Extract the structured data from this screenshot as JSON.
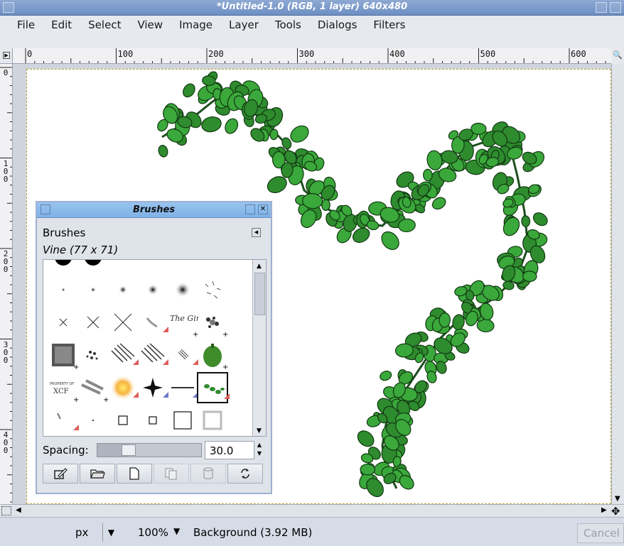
{
  "window": {
    "title": "*Untitled-1.0 (RGB, 1 layer) 640x480"
  },
  "menu": {
    "items": [
      "File",
      "Edit",
      "Select",
      "View",
      "Image",
      "Layer",
      "Tools",
      "Dialogs",
      "Filters"
    ]
  },
  "rulers": {
    "horizontal_labels": [
      "0",
      "100",
      "200",
      "300",
      "400",
      "500",
      "600"
    ],
    "vertical_labels": [
      "0",
      "100",
      "200",
      "300",
      "400"
    ]
  },
  "brushes_dialog": {
    "title": "Brushes",
    "heading": "Brushes",
    "selected_brush": "Vine (77 x 71)",
    "spacing_label": "Spacing:",
    "spacing_value": "30.0",
    "spacing_fraction": 0.3,
    "actions": [
      "edit-brush",
      "open-brush",
      "new-brush",
      "duplicate-brush",
      "delete-brush",
      "refresh-brushes"
    ],
    "brush_text": {
      "gimp_logo": "The Gimp",
      "xcf_line1": "PROPERTY OF",
      "xcf_line2": "XCF"
    }
  },
  "statusbar": {
    "unit": "px",
    "zoom": "100%",
    "status_text": "Background (3.92 MB)",
    "cancel_label": "Cancel"
  },
  "colors": {
    "titlebar": "#7796c8",
    "dialog_titlebar": "#8cbaea",
    "vine_green": "#2e8b2e"
  }
}
